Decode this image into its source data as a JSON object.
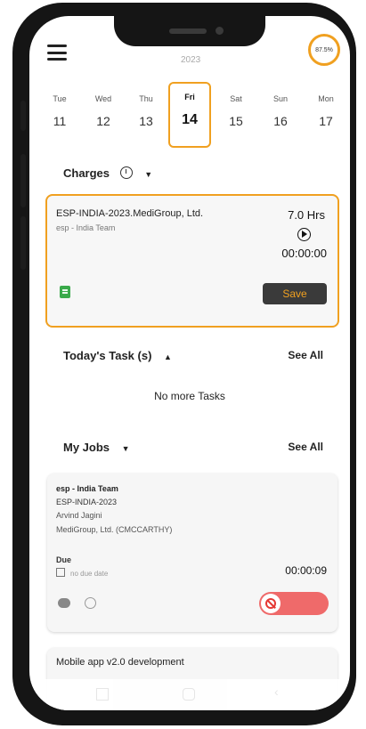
{
  "header": {
    "year": "2023",
    "progress_label": "87.5%"
  },
  "days": [
    {
      "name": "Tue",
      "num": "11"
    },
    {
      "name": "Wed",
      "num": "12"
    },
    {
      "name": "Thu",
      "num": "13"
    },
    {
      "name": "Fri",
      "num": "14"
    },
    {
      "name": "Sat",
      "num": "15"
    },
    {
      "name": "Sun",
      "num": "16"
    },
    {
      "name": "Mon",
      "num": "17"
    }
  ],
  "charges": {
    "heading": "Charges",
    "card": {
      "title": "ESP-INDIA-2023.MediGroup, Ltd.",
      "subtitle": "esp - India Team",
      "hours": "7.0 Hrs",
      "timer": "00:00:00",
      "save_label": "Save"
    }
  },
  "tasks": {
    "heading": "Today's Task (s)",
    "see_all": "See All",
    "empty_text": "No more Tasks"
  },
  "jobs": {
    "heading": "My Jobs",
    "see_all": "See All",
    "items": [
      {
        "team": "esp - India Team",
        "code": "ESP-INDIA-2023",
        "person": "Arvind Jagini",
        "client": "MediGroup, Ltd. (CMCCARTHY)",
        "due_label": "Due",
        "due_value": "no due date",
        "timer": "00:00:09"
      },
      {
        "title": "Mobile app v2.0 development"
      }
    ]
  },
  "colors": {
    "accent": "#f0a020",
    "stop": "#ef6a6a",
    "note": "#3aaa4a"
  }
}
